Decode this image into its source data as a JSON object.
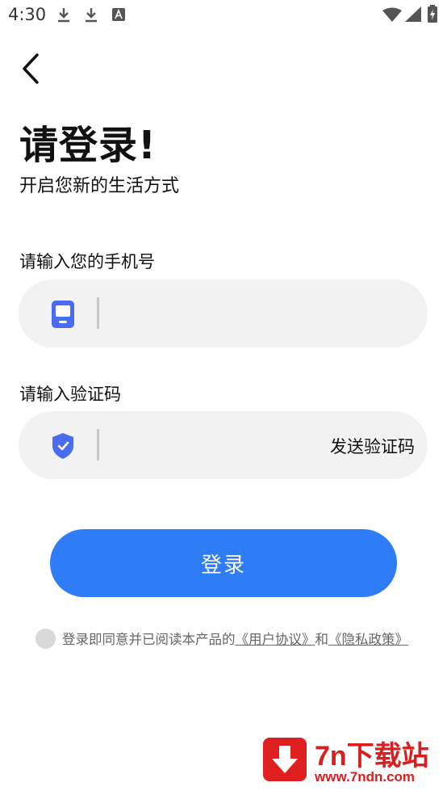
{
  "status_bar": {
    "time": "4:30",
    "icons": [
      "download-icon",
      "download-icon",
      "a-notification-icon",
      "wifi-icon",
      "signal-icon",
      "battery-charging-icon"
    ]
  },
  "header": {
    "back_icon": "chevron-left-icon",
    "title": "请登录!",
    "subtitle": "开启您新的生活方式"
  },
  "phone": {
    "label": "请输入您的手机号",
    "value": "",
    "placeholder": "",
    "icon": "phone-icon"
  },
  "code": {
    "label": "请输入验证码",
    "value": "",
    "placeholder": "",
    "icon": "shield-check-icon",
    "send_label": "发送验证码"
  },
  "login": {
    "label": "登录"
  },
  "agreement": {
    "checked": false,
    "text": "登录即同意并已阅读本产品的",
    "user_agreement": "《用户协议》",
    "conjunction": "和",
    "privacy_policy": "《隐私政策》"
  },
  "watermark": {
    "name": "7n下载站",
    "url": "www.7ndn.com"
  },
  "colors": {
    "accent": "#2e7cf6",
    "field_bg": "#f2f2f2",
    "icon_blue": "#4a6cf0",
    "watermark_red": "#d81e1e"
  }
}
